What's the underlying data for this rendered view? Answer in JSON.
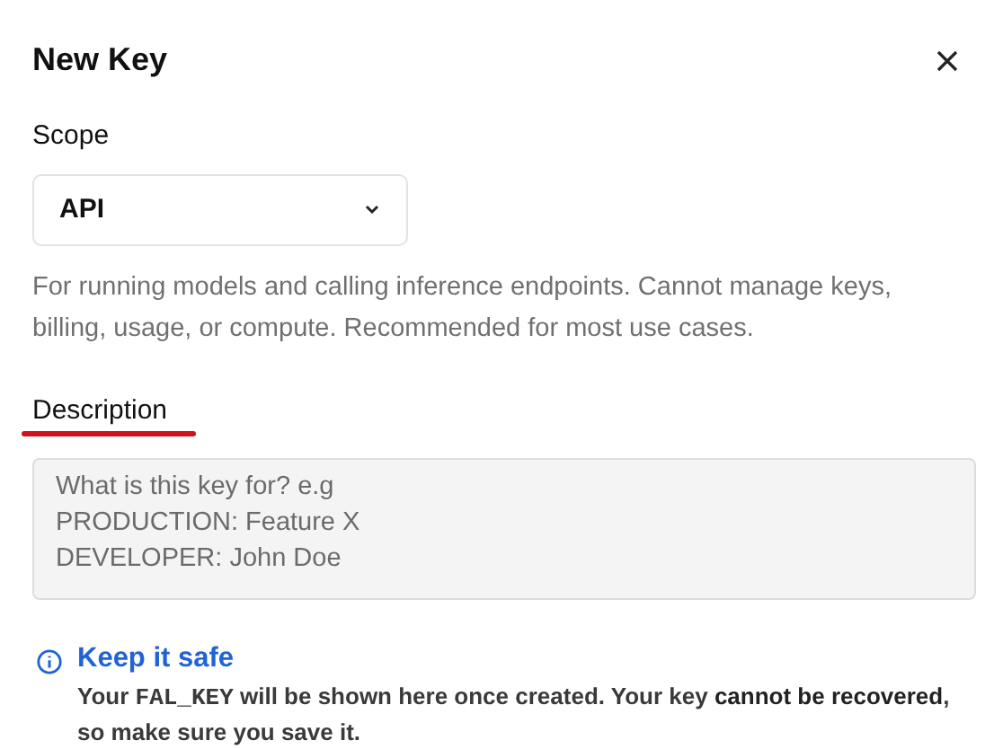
{
  "dialog": {
    "title": "New Key"
  },
  "scope": {
    "label": "Scope",
    "value": "API",
    "help": "For running models and calling inference endpoints. Cannot manage keys, billing, usage, or compute. Recommended for most use cases."
  },
  "description": {
    "label": "Description",
    "underlined": true,
    "placeholder": "What is this key for? e.g\nPRODUCTION: Feature X\nDEVELOPER: John Doe"
  },
  "notice": {
    "title": "Keep it safe",
    "parts": [
      {
        "kind": "plain",
        "text": "Your "
      },
      {
        "kind": "code",
        "text": "FAL_KEY"
      },
      {
        "kind": "plain",
        "text": " will be shown here once created. Your key "
      },
      {
        "kind": "strong",
        "text": "cannot be recovered"
      },
      {
        "kind": "plain",
        "text": ", so make sure you save it."
      }
    ]
  }
}
